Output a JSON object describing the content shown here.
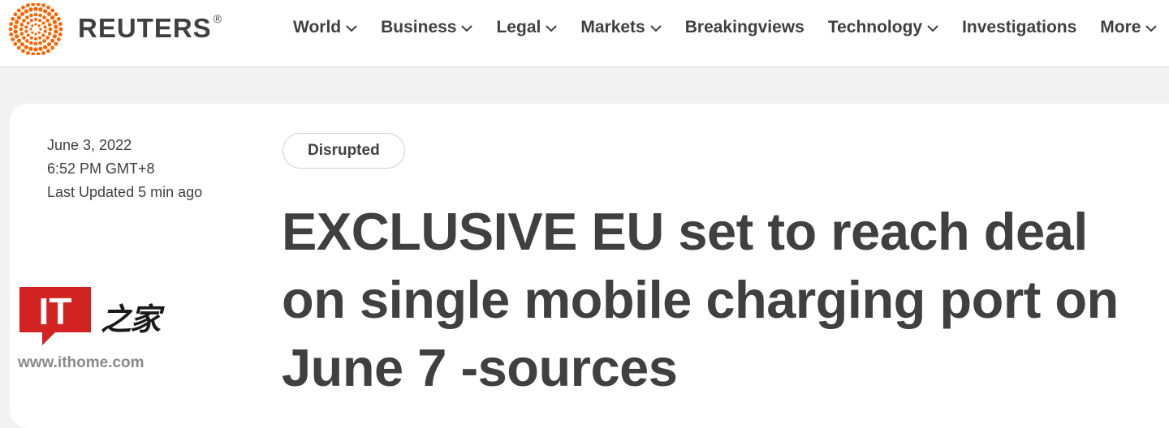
{
  "header": {
    "brand": "REUTERS",
    "brand_mark": "®",
    "logo_icon": "reuters-dot-ring-icon",
    "accent_color": "#fa6400",
    "nav": [
      {
        "label": "World",
        "has_dropdown": true
      },
      {
        "label": "Business",
        "has_dropdown": true
      },
      {
        "label": "Legal",
        "has_dropdown": true
      },
      {
        "label": "Markets",
        "has_dropdown": true
      },
      {
        "label": "Breakingviews",
        "has_dropdown": false
      },
      {
        "label": "Technology",
        "has_dropdown": true
      },
      {
        "label": "Investigations",
        "has_dropdown": false
      },
      {
        "label": "More",
        "has_dropdown": true
      }
    ]
  },
  "article": {
    "date": "June 3, 2022",
    "time": "6:52 PM GMT+8",
    "updated": "Last Updated 5 min ago",
    "tag": "Disrupted",
    "headline": "EXCLUSIVE EU set to reach deal on single mobile charging port on June 7 -sources"
  },
  "watermark": {
    "logo_text": "IT",
    "logo_chars": "之家",
    "url": "www.ithome.com",
    "logo_color": "#d22222"
  }
}
